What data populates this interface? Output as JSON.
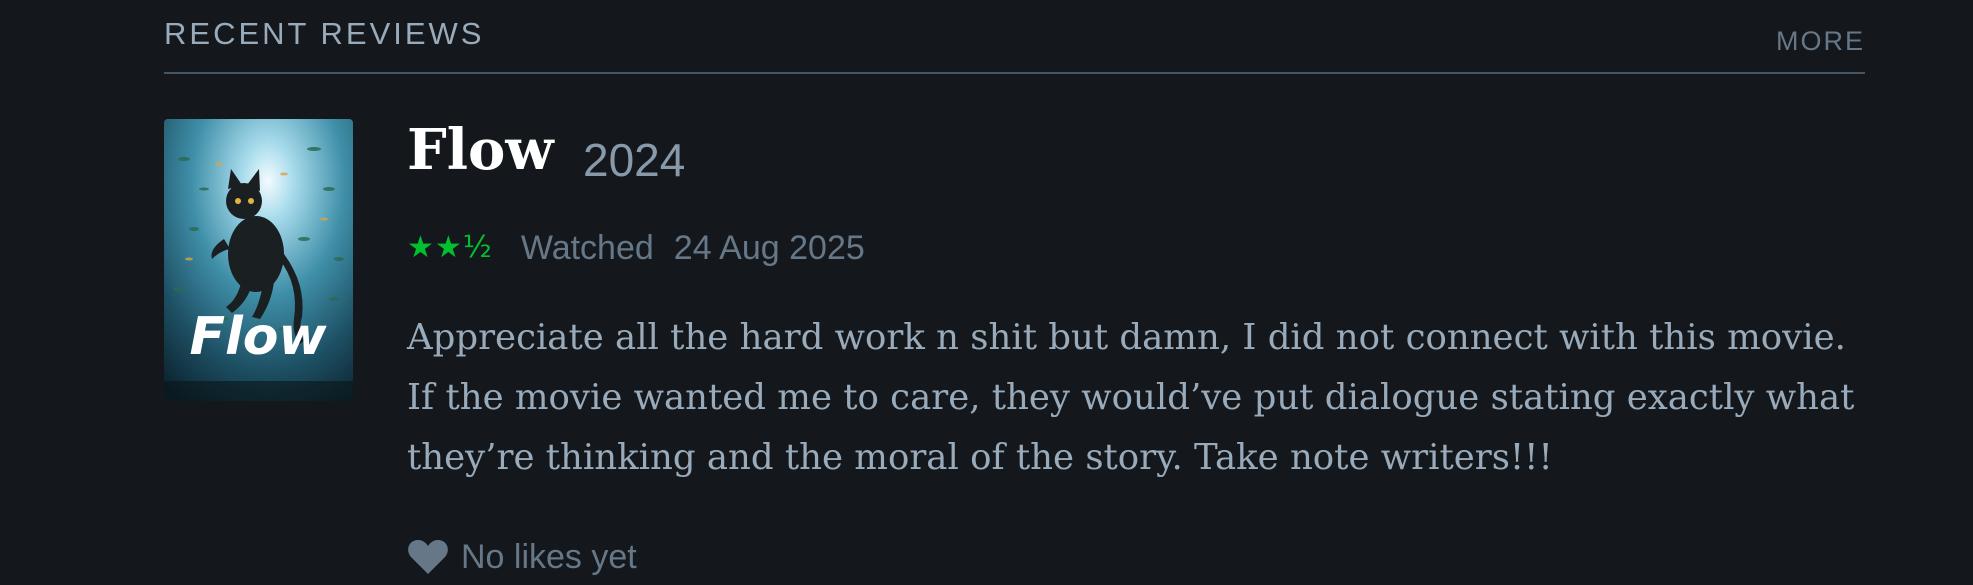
{
  "section": {
    "title": "RECENT REVIEWS",
    "more_label": "MORE"
  },
  "review": {
    "poster_label": "Flow",
    "film_title": "Flow",
    "year": "2024",
    "rating_stars": "★★½",
    "rating_value": 2.5,
    "rating_max": 5,
    "watched_label": "Watched",
    "watched_date": "24 Aug 2025",
    "text": "Appreciate all the hard work n shit but damn, I did not connect with this movie. If the movie wanted me to care, they would’ve put dialogue stating exactly what they’re thinking and the moral of the story. Take note writers!!!",
    "likes_text": "No likes yet"
  },
  "colors": {
    "background": "#14181c",
    "star_green": "#00c030",
    "muted": "#667788",
    "text": "#99aabb"
  }
}
